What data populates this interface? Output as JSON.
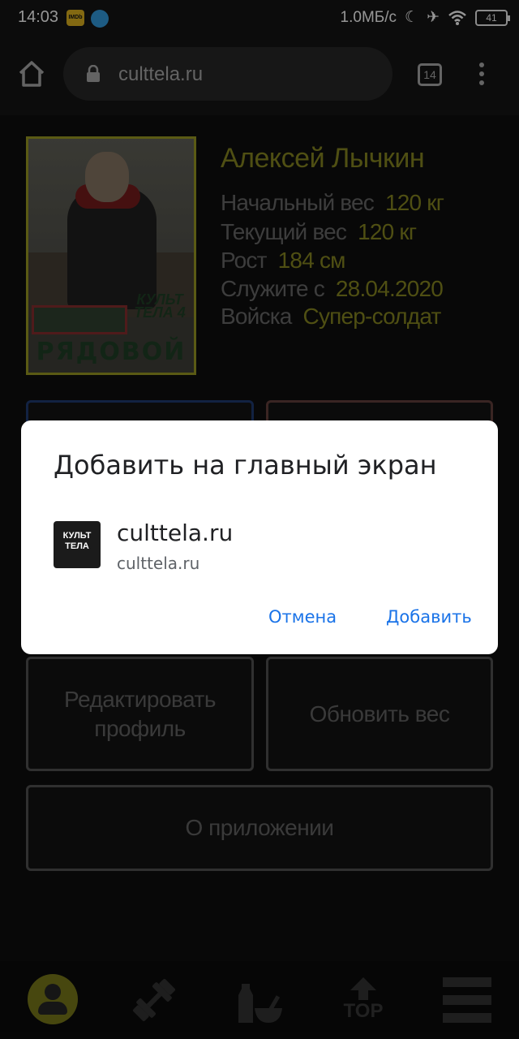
{
  "status_bar": {
    "time": "14:03",
    "imdb_label": "IMDb",
    "net_speed": "1.0МБ/с",
    "battery": "41"
  },
  "browser": {
    "url": "culttela.ru",
    "tab_count": "14"
  },
  "profile": {
    "name": "Алексей Лычкин",
    "rank_label": "РЯДОВОЙ",
    "logo_text": "КУЛЬТ ТЕЛА 4",
    "rows": [
      {
        "label": "Начальный вес",
        "value": "120 кг"
      },
      {
        "label": "Текущий вес",
        "value": "120 кг"
      },
      {
        "label": "Рост",
        "value": "184 см"
      },
      {
        "label": "Служите с",
        "value": "28.04.2020"
      },
      {
        "label": "Войска",
        "value": "Супер-солдат"
      }
    ]
  },
  "actions": {
    "edit_profile": "Редактировать профиль",
    "update_weight": "Обновить вес",
    "about_app": "О приложении"
  },
  "dialog": {
    "title": "Добавить на главный экран",
    "site_name": "culttela.ru",
    "site_url": "culttela.ru",
    "logo_text": "КУЛЬТ ТЕЛА",
    "cancel": "Отмена",
    "add": "Добавить"
  },
  "bottom_nav": {
    "items": [
      "profile-icon",
      "dumbbell-icon",
      "nutrition-icon",
      "top-icon",
      "menu-icon"
    ],
    "top_label": "TOP"
  },
  "colors": {
    "accent_olive": "#7a7a1e",
    "dialog_button": "#1a73e8"
  }
}
